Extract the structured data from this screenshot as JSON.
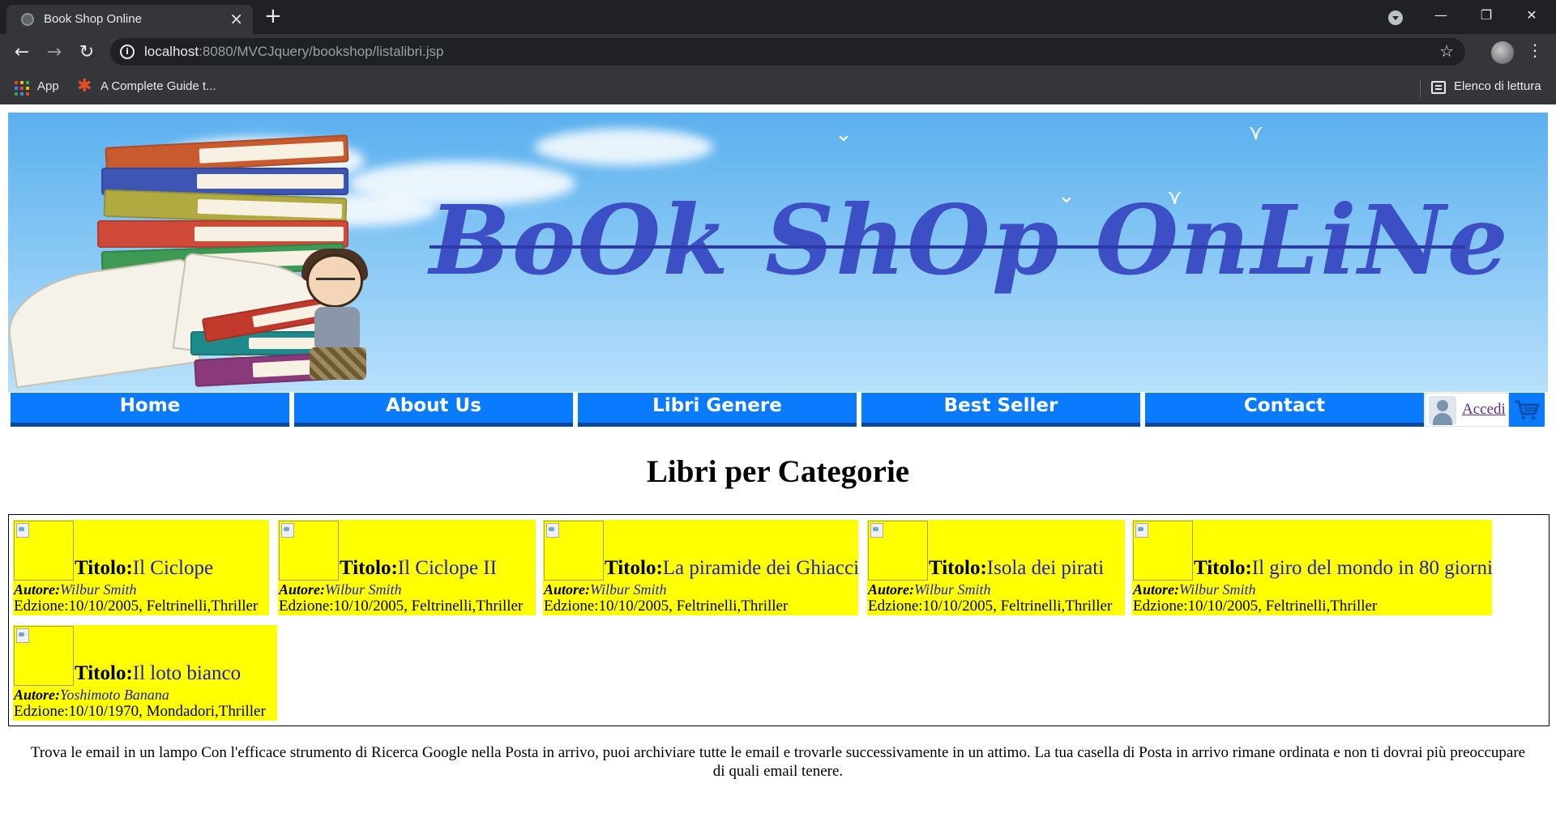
{
  "browser": {
    "tab_title": "Book Shop Online",
    "url_host": "localhost",
    "url_rest": ":8080/MVCJquery/bookshop/listalibri.jsp",
    "bookmarks": [
      {
        "label": "App"
      },
      {
        "label": "A Complete Guide t..."
      }
    ],
    "reading_list": "Elenco di lettura"
  },
  "banner": {
    "title": "BoOk ShOp OnLiNe"
  },
  "nav": {
    "items": [
      "Home",
      "About Us",
      "Libri Genere",
      "Best Seller",
      "Contact"
    ],
    "login": "Accedi"
  },
  "heading": "Libri per Categorie",
  "labels": {
    "title": "Titolo:",
    "author": "Autore:",
    "edition": "Edzione:"
  },
  "books": [
    {
      "title": "Il Ciclope",
      "author": "Wilbur Smith",
      "edition": "10/10/2005, Feltrinelli,Thriller"
    },
    {
      "title": "Il Ciclope II",
      "author": "Wilbur Smith",
      "edition": "10/10/2005, Feltrinelli,Thriller"
    },
    {
      "title": "La piramide dei Ghiacci",
      "author": "Wilbur Smith",
      "edition": "10/10/2005, Feltrinelli,Thriller"
    },
    {
      "title": "Isola dei pirati",
      "author": "Wilbur Smith",
      "edition": "10/10/2005, Feltrinelli,Thriller"
    },
    {
      "title": "Il giro del mondo in 80 giorni",
      "author": "Wilbur Smith",
      "edition": "10/10/2005, Feltrinelli,Thriller"
    },
    {
      "title": "Il loto bianco",
      "author": "Yoshimoto Banana",
      "edition": "10/10/1970, Mondadori,Thriller"
    }
  ],
  "footer": "Trova le email in un lampo Con l'efficace strumento di Ricerca Google nella Posta in arrivo, puoi archiviare tutte le email e trovarle successivamente in un attimo. La tua casella di Posta in arrivo rimane ordinata e non ti dovrai più preoccupare di quali email tenere."
}
